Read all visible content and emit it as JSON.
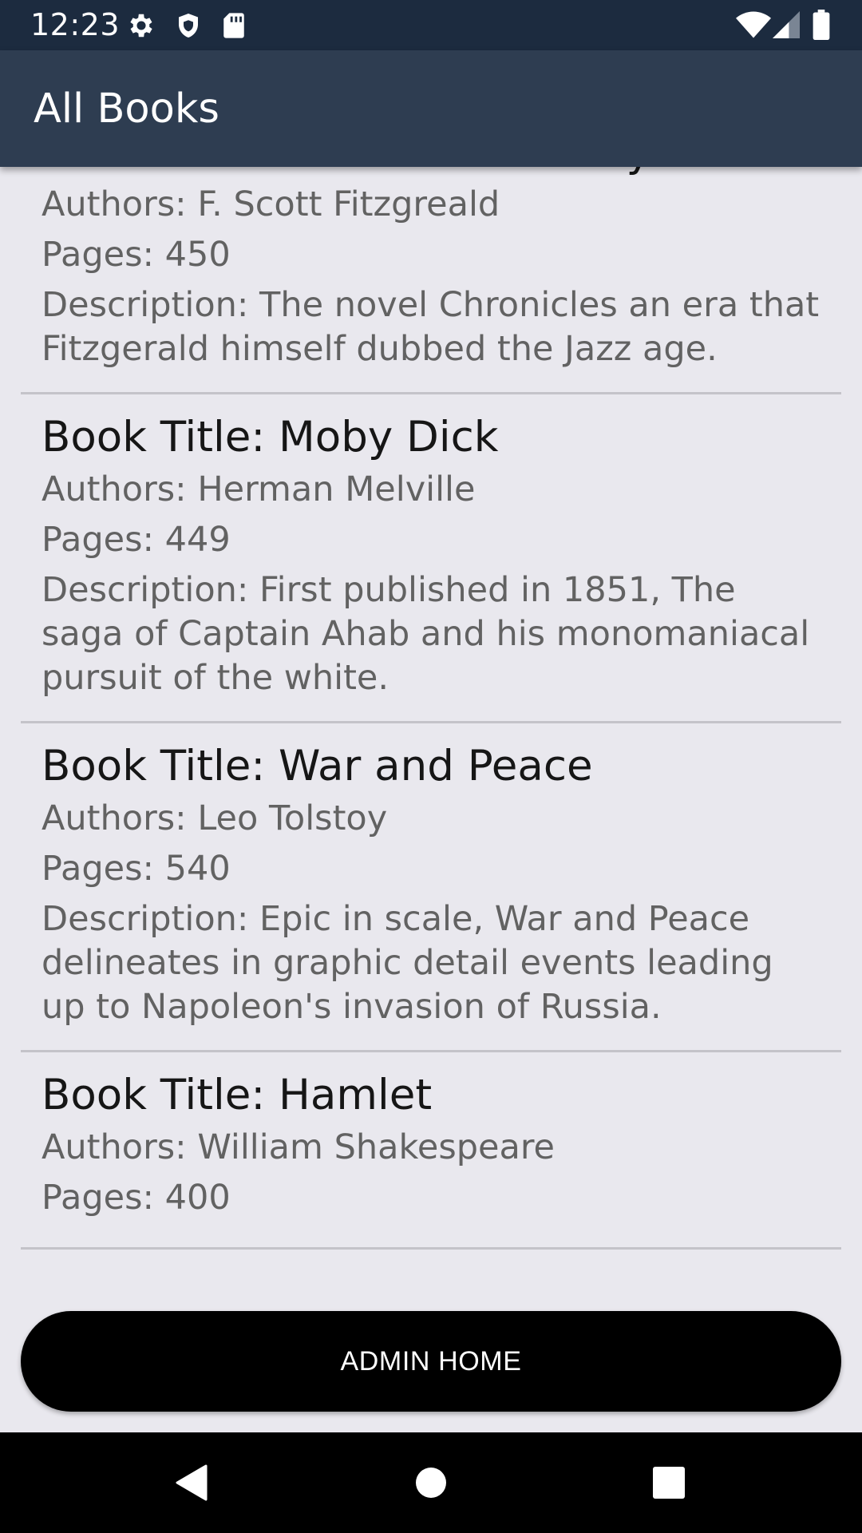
{
  "status_bar": {
    "time": "12:23",
    "left_icons": [
      "gear-icon",
      "shield-icon",
      "sd-card-icon"
    ],
    "right_icons": [
      "wifi-icon",
      "signal-icon",
      "battery-icon"
    ]
  },
  "app_bar": {
    "title": "All Books"
  },
  "books": [
    {
      "title": "Book Title: The Great Gatsby",
      "authors": "Authors: F. Scott Fitzgreald",
      "pages": "Pages: 450",
      "description": "Description: The novel Chronicles an era that Fitzgerald himself dubbed the Jazz age."
    },
    {
      "title": "Book Title: Moby Dick",
      "authors": "Authors: Herman Melville",
      "pages": "Pages: 449",
      "description": "Description: First published in 1851, The saga of Captain Ahab and his monomaniacal pursuit of the white."
    },
    {
      "title": "Book Title: War and Peace",
      "authors": "Authors: Leo Tolstoy",
      "pages": "Pages: 540",
      "description": "Description: Epic in scale, War and Peace delineates in graphic detail events leading up to Napoleon's invasion of Russia."
    },
    {
      "title": "Book Title: Hamlet",
      "authors": "Authors: William Shakespeare",
      "pages": "Pages: 400",
      "description": ""
    }
  ],
  "admin_button": {
    "label": "ADMIN HOME"
  },
  "nav_bar": {
    "buttons": [
      "back-icon",
      "home-icon",
      "recents-icon"
    ]
  },
  "colors": {
    "status_bar": "#1c2b3f",
    "app_bar": "#2e3d51",
    "background": "#e9e8ee",
    "button": "#000000"
  }
}
